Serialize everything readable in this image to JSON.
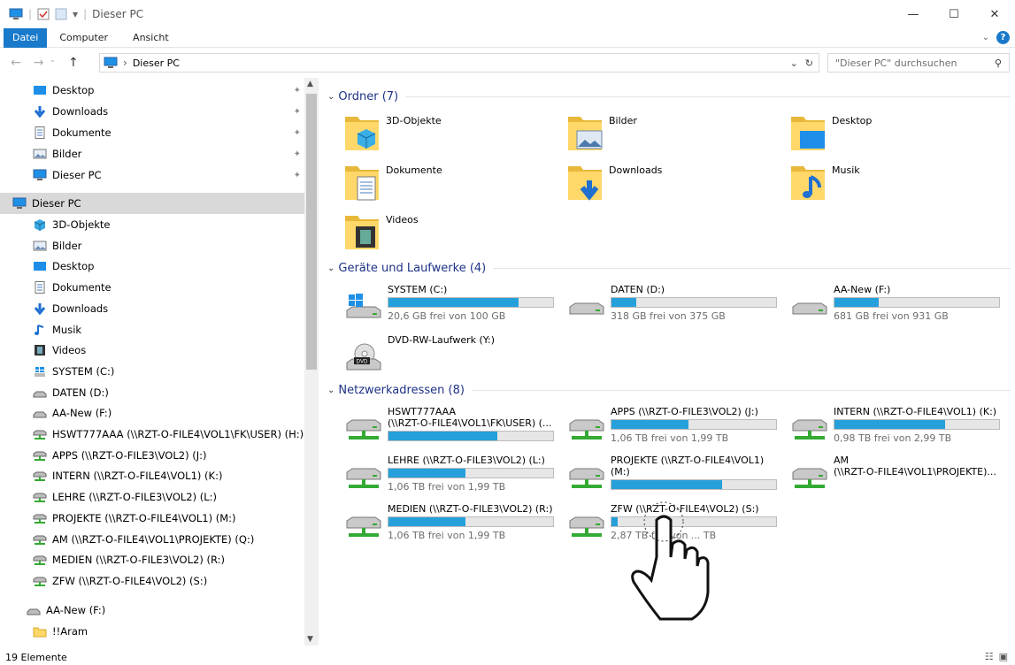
{
  "title": "Dieser PC",
  "ribbon": {
    "tabs": [
      "Datei",
      "Computer",
      "Ansicht"
    ]
  },
  "address": {
    "path": "Dieser PC",
    "search_placeholder": "\"Dieser PC\" durchsuchen"
  },
  "sidebar": {
    "quick": [
      {
        "label": "Desktop",
        "icon": "desktop-icon"
      },
      {
        "label": "Downloads",
        "icon": "download-icon"
      },
      {
        "label": "Dokumente",
        "icon": "document-icon"
      },
      {
        "label": "Bilder",
        "icon": "pictures-icon"
      },
      {
        "label": "Dieser PC",
        "icon": "computer-icon"
      }
    ],
    "thispc": "Dieser PC",
    "items": [
      {
        "label": "3D-Objekte",
        "icon": "3d-icon"
      },
      {
        "label": "Bilder",
        "icon": "pictures-icon"
      },
      {
        "label": "Desktop",
        "icon": "desktop-icon"
      },
      {
        "label": "Dokumente",
        "icon": "document-icon"
      },
      {
        "label": "Downloads",
        "icon": "download-icon"
      },
      {
        "label": "Musik",
        "icon": "music-icon"
      },
      {
        "label": "Videos",
        "icon": "video-icon"
      },
      {
        "label": "SYSTEM (C:)",
        "icon": "windows-drive-icon"
      },
      {
        "label": "DATEN (D:)",
        "icon": "drive-icon"
      },
      {
        "label": "AA-New (F:)",
        "icon": "drive-icon"
      },
      {
        "label": "HSWT777AAA (\\\\RZT-O-FILE4\\VOL1\\FK\\USER) (H:)",
        "icon": "network-drive-icon"
      },
      {
        "label": "APPS (\\\\RZT-O-FILE3\\VOL2) (J:)",
        "icon": "network-drive-icon"
      },
      {
        "label": "INTERN (\\\\RZT-O-FILE4\\VOL1) (K:)",
        "icon": "network-drive-icon"
      },
      {
        "label": "LEHRE (\\\\RZT-O-FILE3\\VOL2) (L:)",
        "icon": "network-drive-icon"
      },
      {
        "label": "PROJEKTE (\\\\RZT-O-FILE4\\VOL1) (M:)",
        "icon": "network-drive-icon"
      },
      {
        "label": "AM (\\\\RZT-O-FILE4\\VOL1\\PROJEKTE) (Q:)",
        "icon": "network-drive-icon"
      },
      {
        "label": "MEDIEN (\\\\RZT-O-FILE3\\VOL2) (R:)",
        "icon": "network-drive-icon"
      },
      {
        "label": "ZFW (\\\\RZT-O-FILE4\\VOL2) (S:)",
        "icon": "network-drive-icon"
      }
    ],
    "extra": [
      {
        "label": "AA-New (F:)",
        "icon": "drive-icon"
      },
      {
        "label": "!!Aram",
        "icon": "folder-icon"
      }
    ]
  },
  "groups": {
    "folders": "Ordner (7)",
    "drives": "Geräte und Laufwerke (4)",
    "network": "Netzwerkadressen (8)"
  },
  "folders": [
    {
      "label": "3D-Objekte",
      "icon": "3d-folder-icon"
    },
    {
      "label": "Bilder",
      "icon": "pictures-folder-icon"
    },
    {
      "label": "Desktop",
      "icon": "desktop-folder-icon"
    },
    {
      "label": "Dokumente",
      "icon": "documents-folder-icon"
    },
    {
      "label": "Downloads",
      "icon": "downloads-folder-icon"
    },
    {
      "label": "Musik",
      "icon": "music-folder-icon"
    },
    {
      "label": "Videos",
      "icon": "videos-folder-icon"
    }
  ],
  "drives": [
    {
      "label": "SYSTEM (C:)",
      "free": "20,6 GB frei von 100 GB",
      "used": 0.79,
      "icon": "windows-drive-icon"
    },
    {
      "label": "DATEN (D:)",
      "free": "318 GB frei von 375 GB",
      "used": 0.15,
      "icon": "drive-icon"
    },
    {
      "label": "AA-New (F:)",
      "free": "681 GB frei von 931 GB",
      "used": 0.27,
      "icon": "drive-icon"
    },
    {
      "label": "DVD-RW-Laufwerk (Y:)",
      "free": "",
      "used": null,
      "icon": "dvd-icon"
    }
  ],
  "network": [
    {
      "label": "HSWT777AAA\n(\\\\RZT-O-FILE4\\VOL1\\FK\\USER) (...",
      "free": "",
      "used": 0.66
    },
    {
      "label": "APPS (\\\\RZT-O-FILE3\\VOL2) (J:)",
      "free": "1,06 TB frei von 1,99 TB",
      "used": 0.47
    },
    {
      "label": "INTERN (\\\\RZT-O-FILE4\\VOL1) (K:)",
      "free": "0,98 TB frei von 2,99 TB",
      "used": 0.67
    },
    {
      "label": "LEHRE (\\\\RZT-O-FILE3\\VOL2) (L:)",
      "free": "1,06 TB frei von 1,99 TB",
      "used": 0.47
    },
    {
      "label": "PROJEKTE (\\\\RZT-O-FILE4\\VOL1)\n(M:)",
      "free": "",
      "used": 0.67
    },
    {
      "label": "AM\n(\\\\RZT-O-FILE4\\VOL1\\PROJEKTE)...",
      "free": "",
      "used": null
    },
    {
      "label": "MEDIEN (\\\\RZT-O-FILE3\\VOL2) (R:)",
      "free": "1,06 TB frei von 1,99 TB",
      "used": 0.47
    },
    {
      "label": "ZFW (\\\\RZT-O-FILE4\\VOL2) (S:)",
      "free": "2,87 TB frei von ... TB",
      "used": 0.04
    }
  ],
  "status": "19 Elemente",
  "colors": {
    "accent": "#1979ca",
    "bar": "#26a0da",
    "group": "#1e3287"
  }
}
